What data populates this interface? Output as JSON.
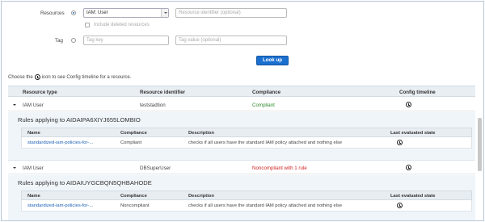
{
  "filters": {
    "resources_label": "Resources",
    "resource_type_value": "IAM: User",
    "resource_id_placeholder": "Resource identifier (optional)",
    "include_deleted_label": "Include deleted resources",
    "tag_label": "Tag",
    "tag_key_placeholder": "Tag key",
    "tag_value_placeholder": "Tag value (optional)",
    "lookup_label": "Look up"
  },
  "hint": {
    "prefix": "Choose the",
    "icon": "clock-icon",
    "suffix": "icon to see Config timeline for a resource."
  },
  "table": {
    "headers": [
      "Resource type",
      "Resource identifier",
      "Compliance",
      "Config timeline"
    ],
    "rows": [
      {
        "type": "IAM User",
        "identifier": "teststadtion",
        "compliance": "Compliant",
        "compliance_status": "compliant",
        "rules_title": "Rules applying to AIDAIPA6XIYJ655LOMBIO",
        "rule_headers": [
          "Name",
          "Compliance",
          "Description",
          "Last evaluated state"
        ],
        "rules": [
          {
            "name": "standardized-iam-policies-for-...",
            "compliance": "Compliant",
            "description": "checks if all users have the standard IAM policy attached and nothing else"
          }
        ]
      },
      {
        "type": "IAM User",
        "identifier": "DBSuperUser",
        "compliance": "Noncompliant with 1 rule",
        "compliance_status": "noncompliant",
        "rules_title": "Rules applying to AIDAIUYGCBQN5QHBAHODE",
        "rule_headers": [
          "Name",
          "Compliance",
          "Description",
          "Last evaluated state"
        ],
        "rules": [
          {
            "name": "standardized-iam-policies-for-...",
            "compliance": "Noncompliant",
            "description": "checks if all users have the standard IAM policy attached and nothing else"
          }
        ]
      }
    ]
  },
  "colors": {
    "accent": "#1a6fcf",
    "compliant": "#2e8b2e",
    "noncompliant": "#d12424",
    "link": "#1a5fb4"
  }
}
